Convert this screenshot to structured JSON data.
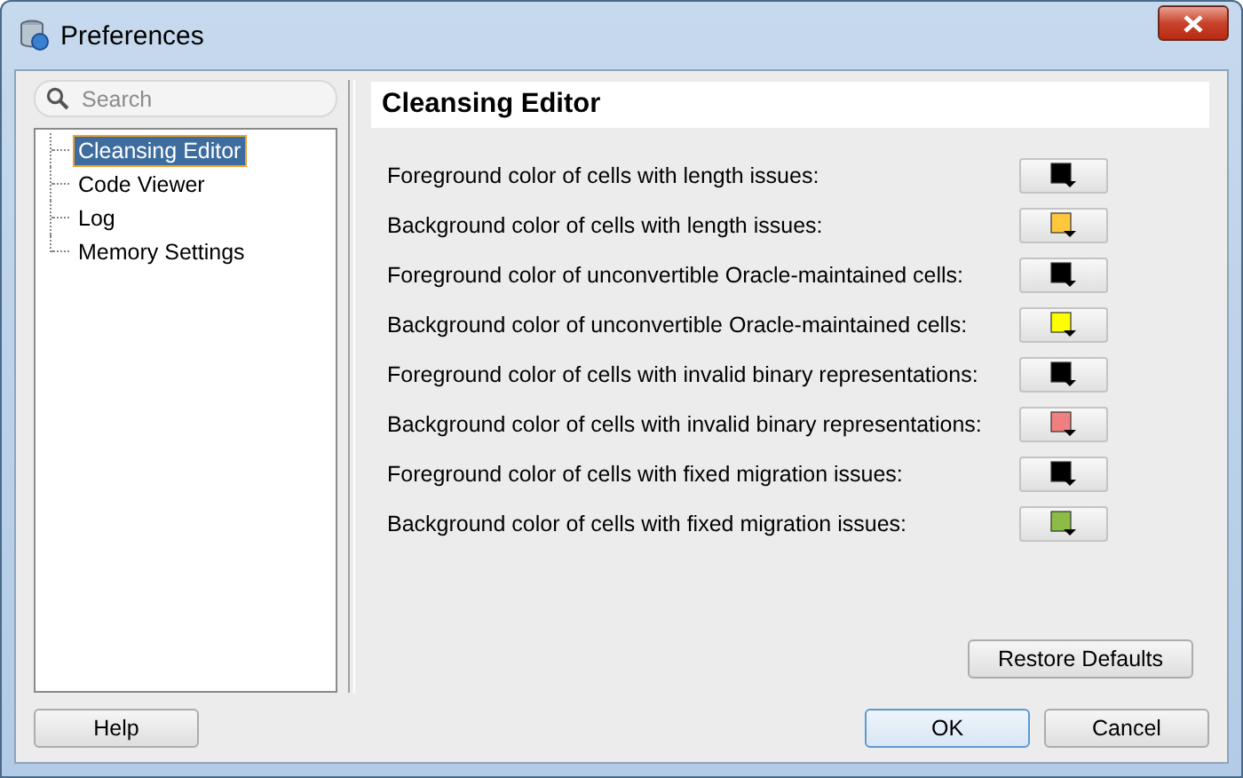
{
  "window": {
    "title": "Preferences"
  },
  "search": {
    "placeholder": "Search"
  },
  "tree": [
    {
      "label": "Cleansing Editor",
      "selected": true
    },
    {
      "label": "Code Viewer",
      "selected": false
    },
    {
      "label": "Log",
      "selected": false
    },
    {
      "label": "Memory Settings",
      "selected": false
    }
  ],
  "panel": {
    "title": "Cleansing Editor"
  },
  "settings": [
    {
      "label": "Foreground color of cells with length issues:",
      "color": "#000000"
    },
    {
      "label": "Background color of cells with length issues:",
      "color": "#ffc83c"
    },
    {
      "label": "Foreground color of unconvertible Oracle-maintained cells:",
      "color": "#000000"
    },
    {
      "label": "Background color of unconvertible Oracle-maintained cells:",
      "color": "#ffff00"
    },
    {
      "label": "Foreground color of cells with invalid binary representations:",
      "color": "#000000"
    },
    {
      "label": "Background color of cells with invalid binary representations:",
      "color": "#f08080"
    },
    {
      "label": "Foreground color of cells with fixed migration issues:",
      "color": "#000000"
    },
    {
      "label": "Background color of cells with fixed migration issues:",
      "color": "#8cbc46"
    }
  ],
  "restore_button": "Restore Defaults",
  "buttons": [
    {
      "label": "Help",
      "kind": "left"
    },
    {
      "label": "OK",
      "kind": "default"
    },
    {
      "label": "Cancel",
      "kind": "normal"
    }
  ]
}
